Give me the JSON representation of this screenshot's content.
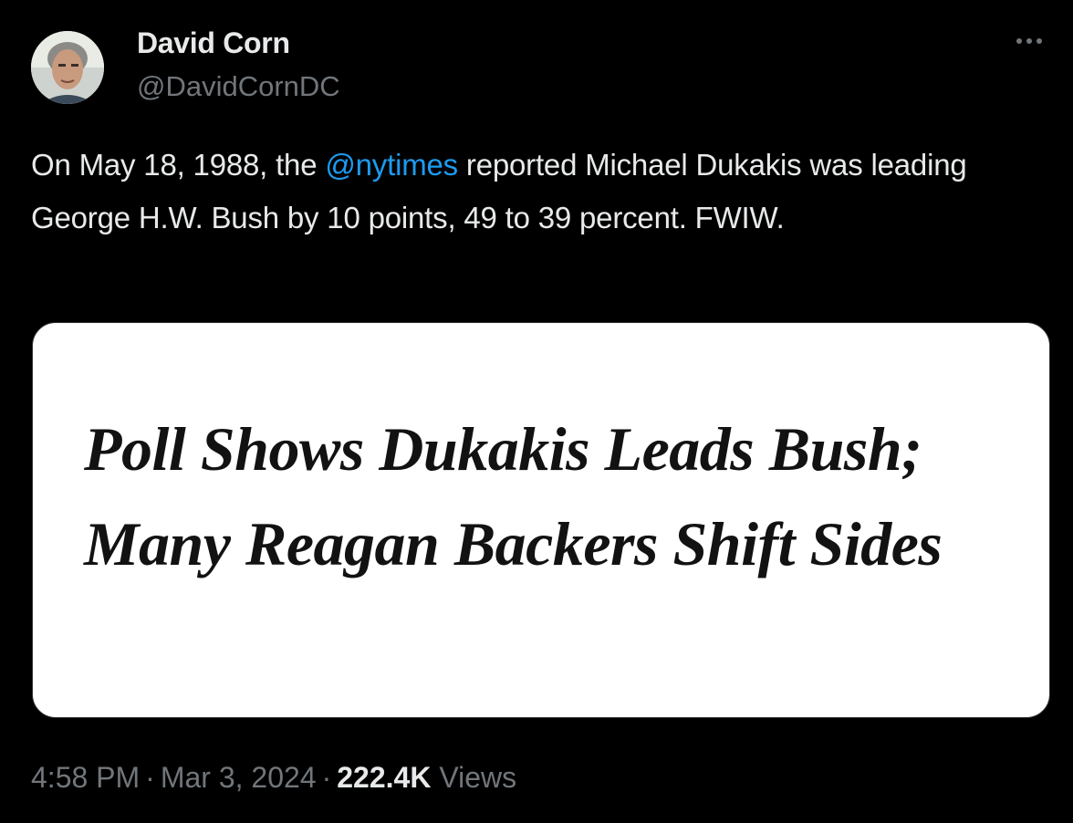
{
  "author": {
    "display_name": "David Corn",
    "handle": "@DavidCornDC"
  },
  "tweet": {
    "text_before_mention": "On May 18, 1988, the ",
    "mention": "@nytimes",
    "text_after_mention": " reported Michael Dukakis was leading George H.W. Bush by 10 points, 49 to 39 percent. FWIW."
  },
  "media": {
    "headline": "Poll Shows Dukakis Leads Bush; Many Reagan Backers Shift Sides"
  },
  "meta": {
    "time": "4:58 PM",
    "separator": "·",
    "date": "Mar 3, 2024",
    "views_count": "222.4K",
    "views_label": "Views"
  },
  "icons": {
    "more": "more-horizontal-icon",
    "avatar": "profile-photo"
  },
  "colors": {
    "background": "#000000",
    "primary_text": "#e7e9ea",
    "secondary_text": "#71767b",
    "link": "#1d9bf0",
    "card_background": "#ffffff"
  }
}
